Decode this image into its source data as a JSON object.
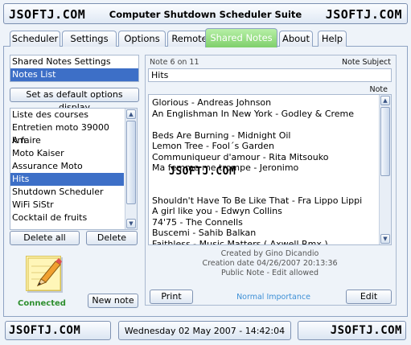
{
  "title_bar": {
    "left_watermark": "JSOFTJ.COM",
    "title": "Computer Shutdown Scheduler Suite",
    "right_watermark": "JSOFTJ.COM"
  },
  "tabs": [
    {
      "label": "Scheduler"
    },
    {
      "label": "Settings"
    },
    {
      "label": "Options"
    },
    {
      "label": "Remote"
    },
    {
      "label": "Shared Notes"
    },
    {
      "label": "About"
    },
    {
      "label": "Help"
    }
  ],
  "active_tab": "Shared Notes",
  "left_nav": {
    "items": [
      {
        "label": "Shared Notes Settings"
      },
      {
        "label": "Notes List"
      }
    ],
    "selected": "Notes List"
  },
  "set_default_button": "Set as default options display",
  "notes_list": {
    "items": [
      "Liste des courses",
      "Entretien moto 39000 km",
      "A faire",
      "Moto Kaiser",
      "Assurance Moto",
      "Hits",
      "Shutdown Scheduler",
      "WiFi SiStr",
      "Cocktail de fruits"
    ],
    "selected": "Hits"
  },
  "delete_all_button": "Delete all",
  "delete_button": "Delete",
  "connection_status": "Connected",
  "new_note_button": "New note",
  "note": {
    "counter": "Note 6 on 11",
    "subject_label": "Note Subject",
    "subject_value": "Hits",
    "note_label": "Note",
    "lines": [
      "Glorious - Andreas Johnson",
      "An Englishman In New York - Godley & Creme",
      "",
      "Beds Are Burning - Midnight Oil",
      "Lemon Tree - Fool´s Garden",
      "Communiqueur d'amour - Rita Mitsouko",
      "Ma femme me trompe - Jeronimo",
      "",
      "",
      "Shouldn't Have To Be Like That - Fra Lippo Lippi",
      "A girl like you - Edwyn Collins",
      "74'75 - The Connells",
      "Buscemi - Sahib Balkan",
      "Faithless - Music Matters ( Axwell Rmx )"
    ],
    "watermark": "JSOFTJ.COM",
    "created_by": "Created by Gino Dicandio",
    "creation_date": "Creation date 04/26/2007 20:13:36",
    "visibility": "Public Note - Edit allowed",
    "importance": "Normal Importance"
  },
  "print_button": "Print",
  "edit_button": "Edit",
  "status_bar": {
    "left_watermark": "JSOFTJ.COM",
    "datetime": "Wednesday 02 May 2007 - 14:42:04",
    "right_watermark": "JSOFTJ.COM"
  },
  "colors": {
    "active_tab": "#7fcf6b",
    "selection": "#3d6fc7",
    "connected": "#2e8f2e",
    "importance": "#3d8fd6"
  }
}
